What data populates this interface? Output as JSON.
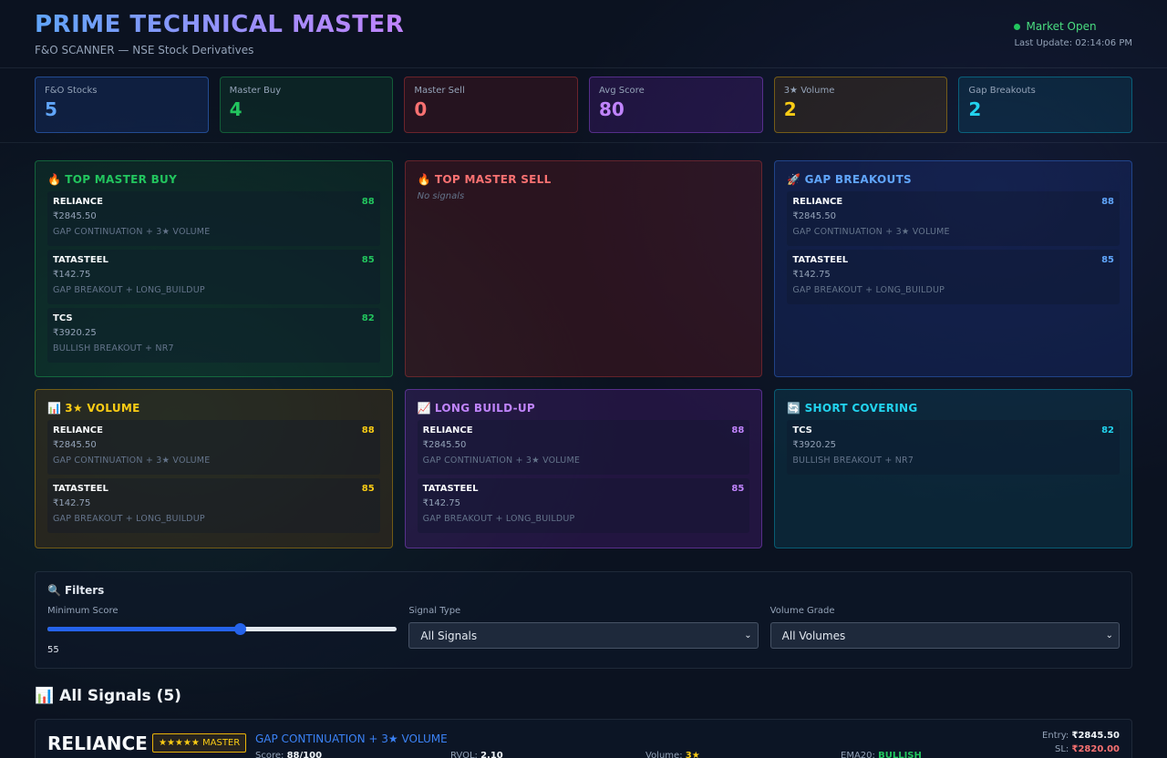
{
  "header": {
    "title": "PRIME TECHNICAL MASTER",
    "subtitle": "F&O SCANNER — NSE Stock Derivatives",
    "market_status": "Market Open",
    "last_update": "Last Update: 02:14:06 PM"
  },
  "stats": [
    {
      "label": "F&O Stocks",
      "value": "5"
    },
    {
      "label": "Master Buy",
      "value": "4"
    },
    {
      "label": "Master Sell",
      "value": "0"
    },
    {
      "label": "Avg Score",
      "value": "80"
    },
    {
      "label": "3★ Volume",
      "value": "2"
    },
    {
      "label": "Gap Breakouts",
      "value": "2"
    }
  ],
  "panels": {
    "master_buy": {
      "icon": "🔥",
      "title": "TOP MASTER BUY",
      "items": [
        {
          "symbol": "RELIANCE",
          "score": "88",
          "price": "₹2845.50",
          "desc": "GAP CONTINUATION + 3★ VOLUME"
        },
        {
          "symbol": "TATASTEEL",
          "score": "85",
          "price": "₹142.75",
          "desc": "GAP BREAKOUT + LONG_BUILDUP"
        },
        {
          "symbol": "TCS",
          "score": "82",
          "price": "₹3920.25",
          "desc": "BULLISH BREAKOUT + NR7"
        }
      ]
    },
    "master_sell": {
      "icon": "🔥",
      "title": "TOP MASTER SELL",
      "empty": "No signals"
    },
    "gap_breakouts": {
      "icon": "🚀",
      "title": "GAP BREAKOUTS",
      "items": [
        {
          "symbol": "RELIANCE",
          "score": "88",
          "price": "₹2845.50",
          "desc": "GAP CONTINUATION + 3★ VOLUME"
        },
        {
          "symbol": "TATASTEEL",
          "score": "85",
          "price": "₹142.75",
          "desc": "GAP BREAKOUT + LONG_BUILDUP"
        }
      ]
    },
    "volume": {
      "icon": "📊",
      "title": "3★ VOLUME",
      "items": [
        {
          "symbol": "RELIANCE",
          "score": "88",
          "price": "₹2845.50",
          "desc": "GAP CONTINUATION + 3★ VOLUME"
        },
        {
          "symbol": "TATASTEEL",
          "score": "85",
          "price": "₹142.75",
          "desc": "GAP BREAKOUT + LONG_BUILDUP"
        }
      ]
    },
    "long_buildup": {
      "icon": "📈",
      "title": "LONG BUILD-UP",
      "items": [
        {
          "symbol": "RELIANCE",
          "score": "88",
          "price": "₹2845.50",
          "desc": "GAP CONTINUATION + 3★ VOLUME"
        },
        {
          "symbol": "TATASTEEL",
          "score": "85",
          "price": "₹142.75",
          "desc": "GAP BREAKOUT + LONG_BUILDUP"
        }
      ]
    },
    "short_covering": {
      "icon": "🔄",
      "title": "SHORT COVERING",
      "items": [
        {
          "symbol": "TCS",
          "score": "82",
          "price": "₹3920.25",
          "desc": "BULLISH BREAKOUT + NR7"
        }
      ]
    }
  },
  "filters": {
    "icon": "🔍",
    "title": "Filters",
    "min_score_label": "Minimum Score",
    "min_score_value": "55",
    "min_score_fraction": 0.55,
    "signal_type_label": "Signal Type",
    "signal_type_selected": "All Signals",
    "volume_grade_label": "Volume Grade",
    "volume_grade_selected": "All Volumes"
  },
  "all_signals": {
    "icon": "📊",
    "title": "All Signals (5)",
    "first": {
      "symbol": "RELIANCE",
      "badge": "★★★★★ MASTER",
      "pattern": "GAP CONTINUATION + 3★ VOLUME",
      "score_label": "Score:",
      "score": "88/100",
      "rvol_label": "RVOL:",
      "rvol": "2.10",
      "volume_label": "Volume:",
      "volume": "3★",
      "ema_label": "EMA20:",
      "ema": "BULLISH",
      "entry_label": "Entry:",
      "entry": "₹2845.50",
      "sl_label": "SL:",
      "sl": "₹2820.00"
    }
  }
}
